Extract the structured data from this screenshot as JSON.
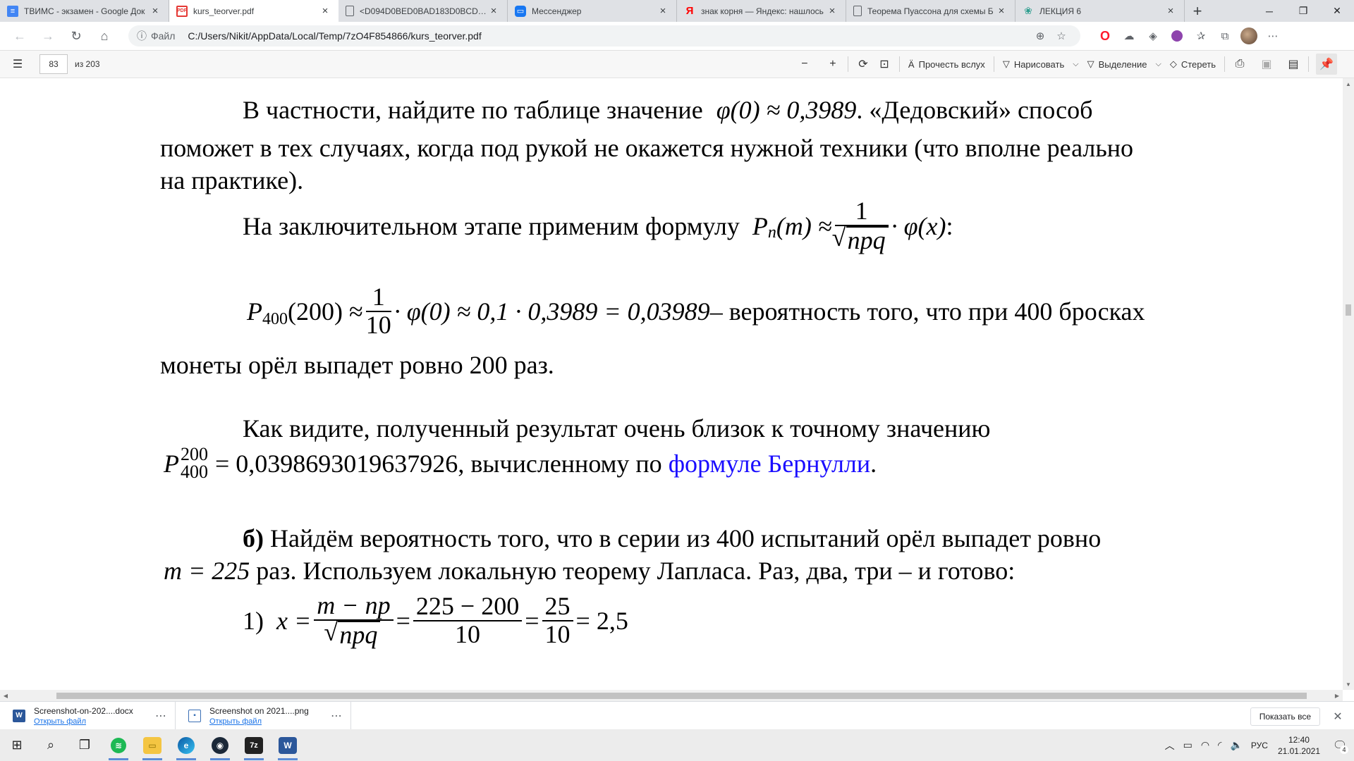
{
  "tabs": [
    {
      "title": "ТВИМС - экзамен - Google Док",
      "icon": "google-docs-icon",
      "color": "#4285f4",
      "active": false
    },
    {
      "title": "kurs_teorver.pdf",
      "icon": "pdf-icon",
      "color": "#e53935",
      "active": true
    },
    {
      "title": "<D094D0BED0BAD183D0BCD0B",
      "icon": "document-icon",
      "color": "#5f6368",
      "active": false
    },
    {
      "title": "Мессенджер",
      "icon": "messenger-icon",
      "color": "#1877f2",
      "active": false
    },
    {
      "title": "знак корня — Яндекс: нашлось",
      "icon": "yandex-icon",
      "color": "#ff0000",
      "active": false
    },
    {
      "title": "Теорема Пуассона для схемы Б",
      "icon": "document-icon",
      "color": "#5f6368",
      "active": false
    },
    {
      "title": "ЛЕКЦИЯ 6",
      "icon": "lecture-icon",
      "color": "#2e9e8f",
      "active": false
    }
  ],
  "address": {
    "label": "Файл",
    "url": "C:/Users/Nikit/AppData/Local/Temp/7zO4F854866/kurs_teorver.pdf"
  },
  "pdf_toolbar": {
    "page": "83",
    "total": "из 203",
    "read_aloud": "Прочесть вслух",
    "draw": "Нарисовать",
    "highlight": "Выделение",
    "erase": "Стереть"
  },
  "doc": {
    "p1_a": "В частности, найдите по таблице значение",
    "p1_formula": "φ(0) ≈ 0,3989",
    "p1_b": ". «Дедовский» способ",
    "p1_line2": "поможет в тех случаях, когда под рукой не окажется нужной техники (что вполне реально",
    "p1_line3": "на практике).",
    "p2": "На заключительном этапе применим формулу",
    "f1_lhs_P": "P",
    "f1_lhs_n": "n",
    "f1_lhs_m": "(m) ≈",
    "f1_num": "1",
    "f1_den": "npq",
    "f1_rhs": "· φ(x)",
    "f1_colon": ":",
    "f2_P": "P",
    "f2_sub": "400",
    "f2_arg": "(200) ≈",
    "f2_num": "1",
    "f2_den": "10",
    "f2_rest": "· φ(0) ≈ 0,1 · 0,3989 = 0,03989",
    "f2_text": " – вероятность того, что при 400 бросках",
    "p3_line2": "монеты орёл выпадет ровно 200 раз.",
    "p4": "Как видите, полученный результат очень близок к точному значению",
    "f3_P": "P",
    "f3_sup": "200",
    "f3_sub": "400",
    "f3_val": "= 0,0398693019637926",
    "f3_text": ", вычисленному по",
    "f3_link": "формуле Бернулли",
    "f3_end": ".",
    "p5_bold": "б)",
    "p5_a": " Найдём вероятность того, что в серии из 400 испытаний орёл выпадет ровно",
    "p5_m": "m = 225",
    "p5_b": " раз. Используем локальную теорему Лапласа. Раз, два, три – и готово:",
    "s1_num": "1)",
    "s1_x": "x =",
    "s1_f1_num": "m − np",
    "s1_f1_den": "npq",
    "s1_eq1": "=",
    "s1_f2_num": "225 − 200",
    "s1_f2_den": "10",
    "s1_eq2": "=",
    "s1_f3_num": "25",
    "s1_f3_den": "10",
    "s1_res": "= 2,5"
  },
  "downloads": [
    {
      "name": "Screenshot-on-202....docx",
      "open": "Открыть файл",
      "icon": "word-doc-icon",
      "color": "#2b579a"
    },
    {
      "name": "Screenshot on 2021....png",
      "open": "Открыть файл",
      "icon": "image-file-icon",
      "color": "#3a6fb5"
    }
  ],
  "show_all": "Показать все",
  "taskbar": {
    "lang": "РУС",
    "time": "12:40",
    "date": "21.01.2021",
    "notifications": "4"
  }
}
